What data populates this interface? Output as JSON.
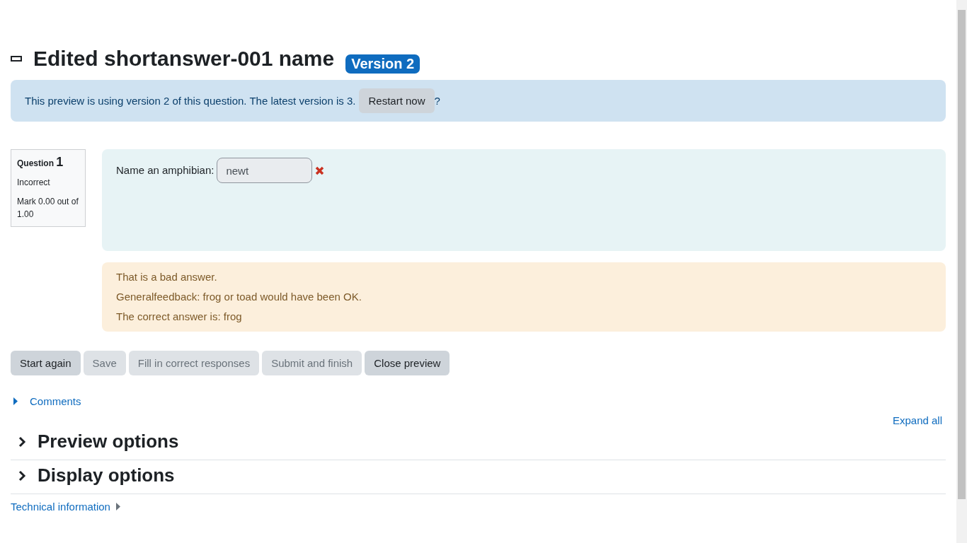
{
  "heading": {
    "title": "Edited shortanswer-001 name",
    "badge": "Version 2"
  },
  "notice": {
    "text": "This preview is using version 2 of this question. The latest version is 3.",
    "button": "Restart now",
    "suffix": "?"
  },
  "question": {
    "label": "Question",
    "number": "1",
    "state": "Incorrect",
    "mark": "Mark 0.00 out of 1.00",
    "prompt": "Name an amphibian:",
    "answer": "newt",
    "correct": false
  },
  "feedback": [
    "That is a bad answer.",
    "Generalfeedback: frog or toad would have been OK.",
    "The correct answer is: frog"
  ],
  "buttons": [
    {
      "label": "Start again",
      "disabled": false
    },
    {
      "label": "Save",
      "disabled": true
    },
    {
      "label": "Fill in correct responses",
      "disabled": true
    },
    {
      "label": "Submit and finish",
      "disabled": true
    },
    {
      "label": "Close preview",
      "disabled": false
    }
  ],
  "comments": {
    "label": "Comments",
    "expanded": false
  },
  "expand_all": "Expand all",
  "sections": [
    {
      "title": "Preview options",
      "expanded": false
    },
    {
      "title": "Display options",
      "expanded": false
    }
  ],
  "technical_info": {
    "label": "Technical information",
    "expanded": false
  }
}
